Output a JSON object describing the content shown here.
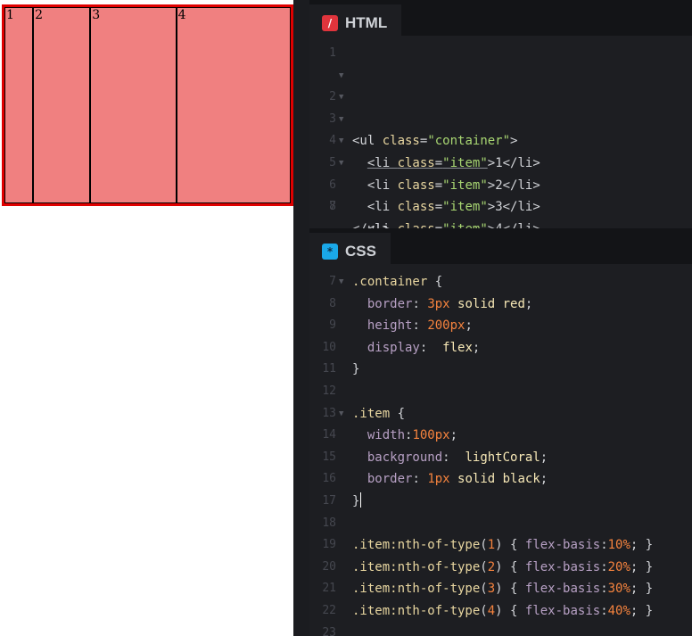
{
  "preview": {
    "items": [
      {
        "label": "1",
        "basis": "10%"
      },
      {
        "label": "2",
        "basis": "20%"
      },
      {
        "label": "3",
        "basis": "30%"
      },
      {
        "label": "4",
        "basis": "40%"
      }
    ]
  },
  "html_editor": {
    "tab_label": "HTML",
    "tab_icon": "/",
    "line_numbers": [
      "1",
      "2",
      "3",
      "4",
      "5",
      "6",
      "7",
      "8"
    ],
    "code": {
      "l2_open": "<ul ",
      "l2_attr": "class",
      "l2_eq": "=",
      "l2_str": "\"container\"",
      "l2_close": ">",
      "li_open": "<li ",
      "li_attr": "class",
      "li_eq": "=",
      "li_str": "\"item\"",
      "li_gt": ">",
      "li_end": "</li>",
      "items": [
        "1",
        "2",
        "3",
        "4"
      ],
      "l7": "</ul>"
    }
  },
  "css_editor": {
    "tab_label": "CSS",
    "tab_icon": "*",
    "line_numbers": [
      "7",
      "8",
      "9",
      "10",
      "11",
      "12",
      "13",
      "14",
      "15",
      "16",
      "17",
      "18",
      "19",
      "20",
      "21",
      "22",
      "23"
    ],
    "container_rule": {
      "selector": ".container",
      "brace_open": " {",
      "decls": [
        {
          "prop": "border",
          "num": "3px",
          "val": " solid red"
        },
        {
          "prop": "height",
          "num": "200px",
          "val": ""
        },
        {
          "prop": "display",
          "num": "",
          "val": " flex"
        }
      ],
      "brace_close": "}"
    },
    "item_rule": {
      "selector": ".item",
      "brace_open": " {",
      "decls": [
        {
          "prop": "width",
          "num": "100px",
          "val": ""
        },
        {
          "prop": "background",
          "num": "",
          "val": " lightCoral"
        },
        {
          "prop": "border",
          "num": "1px",
          "val": " solid black"
        }
      ],
      "brace_close": "}"
    },
    "nth_rules": [
      {
        "selector": ".item:nth-of-type",
        "n": "1",
        "prop": "flex-basis",
        "num": "10%"
      },
      {
        "selector": ".item:nth-of-type",
        "n": "2",
        "prop": "flex-basis",
        "num": "20%"
      },
      {
        "selector": ".item:nth-of-type",
        "n": "3",
        "prop": "flex-basis",
        "num": "30%"
      },
      {
        "selector": ".item:nth-of-type",
        "n": "4",
        "prop": "flex-basis",
        "num": "40%"
      }
    ]
  }
}
